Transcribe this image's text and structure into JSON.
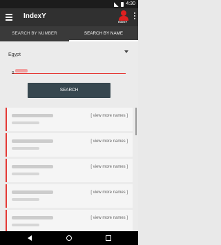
{
  "status": {
    "time": "4:30"
  },
  "app": {
    "title": "IndexY",
    "logo_text": "IndexY"
  },
  "tabs": [
    {
      "label": "SEARCH BY NUMBER",
      "active": false
    },
    {
      "label": "SEARCH BY NAME",
      "active": true
    }
  ],
  "form": {
    "country": "Egypt",
    "query_value": "s",
    "search_button": "SEARCH"
  },
  "results": [
    {
      "more_label": "[ view more names ]"
    },
    {
      "more_label": "[ view more names ]"
    },
    {
      "more_label": "[ view more names ]"
    },
    {
      "more_label": "[ view more names ]"
    },
    {
      "more_label": "[ view more names ]"
    }
  ],
  "colors": {
    "accent": "#e53935",
    "appbar": "#303030",
    "tabs": "#3a3a3a",
    "button": "#37474f"
  }
}
